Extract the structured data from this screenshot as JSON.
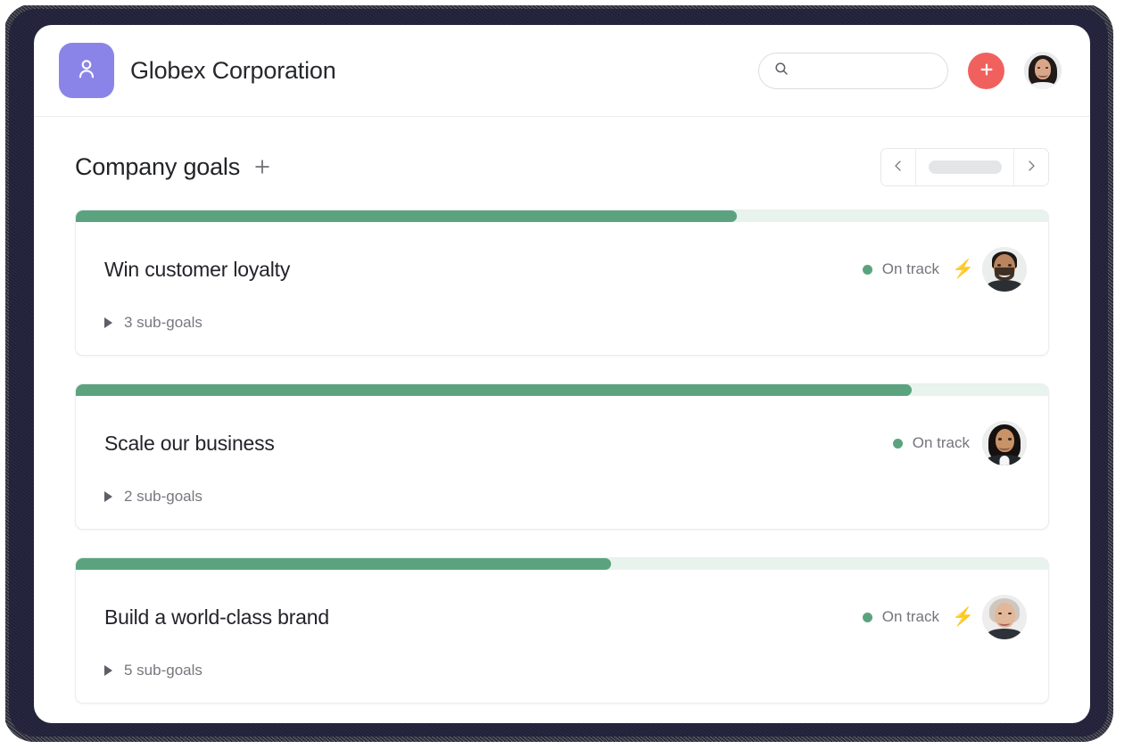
{
  "header": {
    "logo_icon": "person-badge-icon",
    "logo_color": "#8b84e8",
    "title": "Globex Corporation",
    "search": {
      "icon": "search-icon",
      "value": "",
      "placeholder": ""
    },
    "add_button": {
      "icon": "plus-icon",
      "label": "+",
      "color": "#f0615e"
    },
    "avatar": {
      "name": "user-avatar"
    }
  },
  "section": {
    "title": "Company goals",
    "add_icon": "plus-icon",
    "pager": {
      "prev_icon": "chevron-left-icon",
      "next_icon": "chevron-right-icon",
      "label": ""
    }
  },
  "status_colors": {
    "on_track": "#5ba37f",
    "progress_fill": "#5ba37f",
    "progress_track": "#e8f3ed"
  },
  "goals": [
    {
      "title": "Win customer loyalty",
      "progress": 68,
      "status": "On track",
      "has_bolt": true,
      "bolt_icon": "lightning-bolt-icon",
      "subgoals_label": "3 sub-goals",
      "subgoals_count": 3,
      "avatar_class": "av-m1",
      "disclosure_icon": "triangle-right-icon"
    },
    {
      "title": "Scale our business",
      "progress": 86,
      "status": "On track",
      "has_bolt": false,
      "bolt_icon": "",
      "subgoals_label": "2 sub-goals",
      "subgoals_count": 2,
      "avatar_class": "av-m2",
      "disclosure_icon": "triangle-right-icon"
    },
    {
      "title": "Build a world-class brand",
      "progress": 55,
      "status": "On track",
      "has_bolt": true,
      "bolt_icon": "lightning-bolt-icon",
      "subgoals_label": "5 sub-goals",
      "subgoals_count": 5,
      "avatar_class": "av-m3",
      "disclosure_icon": "triangle-right-icon"
    }
  ]
}
